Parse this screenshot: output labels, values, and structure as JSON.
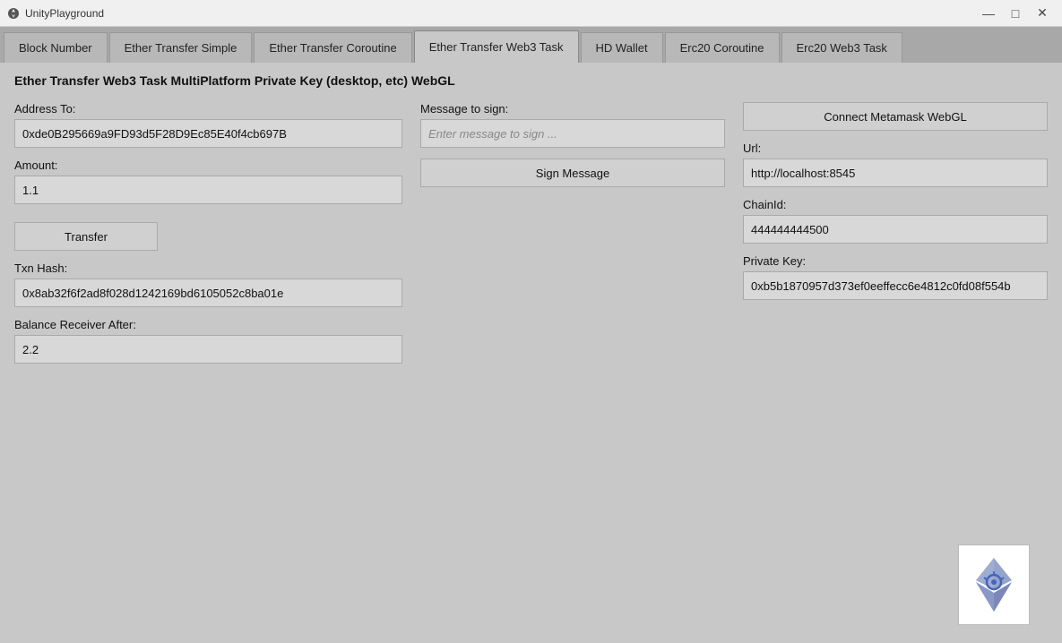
{
  "titleBar": {
    "appName": "UnityPlayground"
  },
  "tabs": [
    {
      "id": "block-number",
      "label": "Block Number",
      "active": false
    },
    {
      "id": "ether-transfer-simple",
      "label": "Ether Transfer Simple",
      "active": false
    },
    {
      "id": "ether-transfer-coroutine",
      "label": "Ether Transfer Coroutine",
      "active": false
    },
    {
      "id": "ether-transfer-web3-task",
      "label": "Ether Transfer Web3 Task",
      "active": true
    },
    {
      "id": "hd-wallet",
      "label": "HD Wallet",
      "active": false
    },
    {
      "id": "erc20-coroutine",
      "label": "Erc20 Coroutine",
      "active": false
    },
    {
      "id": "erc20-web3-task",
      "label": "Erc20 Web3 Task",
      "active": false
    }
  ],
  "pageTitle": "Ether Transfer Web3 Task MultiPlatform Private Key (desktop, etc) WebGL",
  "leftPanel": {
    "addressLabel": "Address To:",
    "addressValue": "0xde0B295669a9FD93d5F28D9Ec85E40f4cb697B",
    "amountLabel": "Amount:",
    "amountValue": "1.1",
    "transferButton": "Transfer",
    "txnHashLabel": "Txn Hash:",
    "txnHashValue": "0x8ab32f6f2ad8f028d1242169bd6105052c8ba01e",
    "balanceLabel": "Balance Receiver After:",
    "balanceValue": "2.2"
  },
  "middlePanel": {
    "messageLabel": "Message to sign:",
    "messagePlaceholder": "Enter message to sign ...",
    "signButton": "Sign Message"
  },
  "rightPanel": {
    "connectButton": "Connect Metamask WebGL",
    "urlLabel": "Url:",
    "urlValue": "http://localhost:8545",
    "chainIdLabel": "ChainId:",
    "chainIdValue": "444444444500",
    "privateKeyLabel": "Private Key:",
    "privateKeyValue": "0xb5b1870957d373ef0eeffecc6e4812c0fd08f554b"
  },
  "windowControls": {
    "minimize": "—",
    "maximize": "□",
    "close": "✕"
  }
}
